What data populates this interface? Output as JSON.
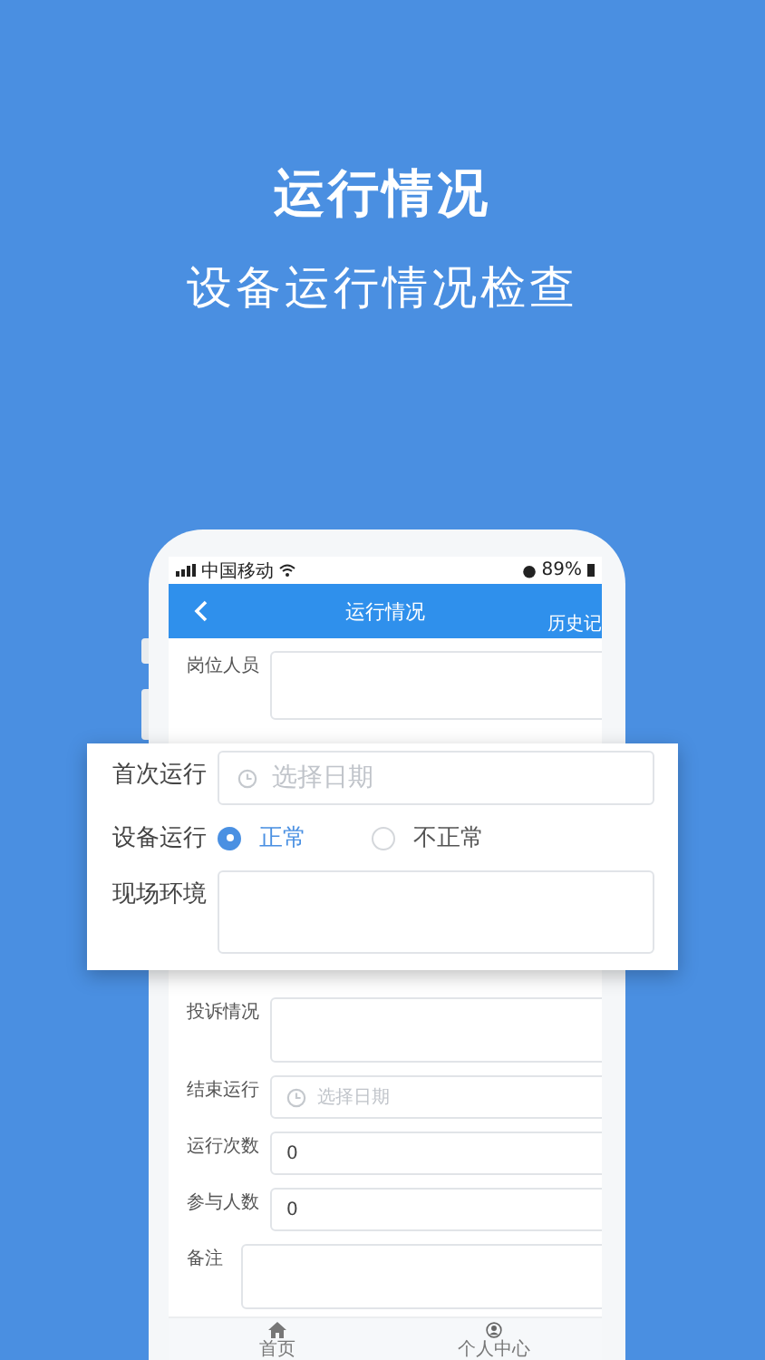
{
  "header": {
    "title": "运行情况",
    "subtitle": "设备运行情况检查"
  },
  "status_bar": {
    "carrier": "中国移动",
    "battery": "89%"
  },
  "nav": {
    "title": "运行情况",
    "action": "历史记"
  },
  "form_top": [
    {
      "kind": "textarea",
      "label": "岗位人员"
    }
  ],
  "form_bottom": [
    {
      "kind": "textarea",
      "label": "投诉情况"
    },
    {
      "kind": "date",
      "label": "结束运行",
      "placeholder": "选择日期"
    },
    {
      "kind": "number",
      "label": "运行次数",
      "value": "0"
    },
    {
      "kind": "number",
      "label": "参与人数",
      "value": "0"
    },
    {
      "kind": "textarea",
      "label": "备注"
    }
  ],
  "popup": [
    {
      "kind": "date",
      "label": "首次运行",
      "placeholder": "选择日期"
    },
    {
      "kind": "radio",
      "label": "设备运行",
      "options": [
        {
          "label": "正常",
          "selected": true
        },
        {
          "label": "不正常",
          "selected": false
        }
      ]
    },
    {
      "kind": "textarea",
      "label": "现场环境"
    }
  ],
  "tab_bar": [
    {
      "kind": "home",
      "label": "首页"
    },
    {
      "kind": "person",
      "label": "个人中心"
    }
  ]
}
